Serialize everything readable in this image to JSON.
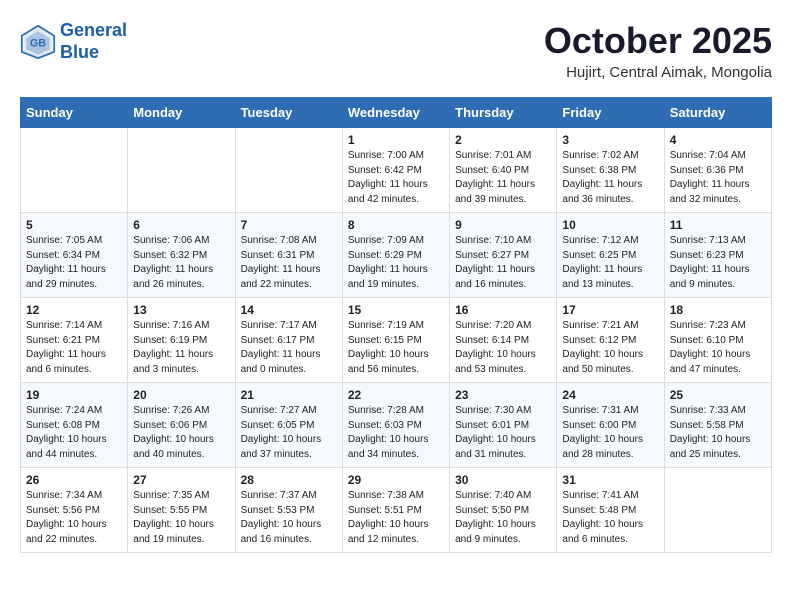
{
  "header": {
    "logo_line1": "General",
    "logo_line2": "Blue",
    "month": "October 2025",
    "location": "Hujirt, Central Aimak, Mongolia"
  },
  "days_of_week": [
    "Sunday",
    "Monday",
    "Tuesday",
    "Wednesday",
    "Thursday",
    "Friday",
    "Saturday"
  ],
  "weeks": [
    [
      {
        "day": "",
        "info": ""
      },
      {
        "day": "",
        "info": ""
      },
      {
        "day": "",
        "info": ""
      },
      {
        "day": "1",
        "info": "Sunrise: 7:00 AM\nSunset: 6:42 PM\nDaylight: 11 hours\nand 42 minutes."
      },
      {
        "day": "2",
        "info": "Sunrise: 7:01 AM\nSunset: 6:40 PM\nDaylight: 11 hours\nand 39 minutes."
      },
      {
        "day": "3",
        "info": "Sunrise: 7:02 AM\nSunset: 6:38 PM\nDaylight: 11 hours\nand 36 minutes."
      },
      {
        "day": "4",
        "info": "Sunrise: 7:04 AM\nSunset: 6:36 PM\nDaylight: 11 hours\nand 32 minutes."
      }
    ],
    [
      {
        "day": "5",
        "info": "Sunrise: 7:05 AM\nSunset: 6:34 PM\nDaylight: 11 hours\nand 29 minutes."
      },
      {
        "day": "6",
        "info": "Sunrise: 7:06 AM\nSunset: 6:32 PM\nDaylight: 11 hours\nand 26 minutes."
      },
      {
        "day": "7",
        "info": "Sunrise: 7:08 AM\nSunset: 6:31 PM\nDaylight: 11 hours\nand 22 minutes."
      },
      {
        "day": "8",
        "info": "Sunrise: 7:09 AM\nSunset: 6:29 PM\nDaylight: 11 hours\nand 19 minutes."
      },
      {
        "day": "9",
        "info": "Sunrise: 7:10 AM\nSunset: 6:27 PM\nDaylight: 11 hours\nand 16 minutes."
      },
      {
        "day": "10",
        "info": "Sunrise: 7:12 AM\nSunset: 6:25 PM\nDaylight: 11 hours\nand 13 minutes."
      },
      {
        "day": "11",
        "info": "Sunrise: 7:13 AM\nSunset: 6:23 PM\nDaylight: 11 hours\nand 9 minutes."
      }
    ],
    [
      {
        "day": "12",
        "info": "Sunrise: 7:14 AM\nSunset: 6:21 PM\nDaylight: 11 hours\nand 6 minutes."
      },
      {
        "day": "13",
        "info": "Sunrise: 7:16 AM\nSunset: 6:19 PM\nDaylight: 11 hours\nand 3 minutes."
      },
      {
        "day": "14",
        "info": "Sunrise: 7:17 AM\nSunset: 6:17 PM\nDaylight: 11 hours\nand 0 minutes."
      },
      {
        "day": "15",
        "info": "Sunrise: 7:19 AM\nSunset: 6:15 PM\nDaylight: 10 hours\nand 56 minutes."
      },
      {
        "day": "16",
        "info": "Sunrise: 7:20 AM\nSunset: 6:14 PM\nDaylight: 10 hours\nand 53 minutes."
      },
      {
        "day": "17",
        "info": "Sunrise: 7:21 AM\nSunset: 6:12 PM\nDaylight: 10 hours\nand 50 minutes."
      },
      {
        "day": "18",
        "info": "Sunrise: 7:23 AM\nSunset: 6:10 PM\nDaylight: 10 hours\nand 47 minutes."
      }
    ],
    [
      {
        "day": "19",
        "info": "Sunrise: 7:24 AM\nSunset: 6:08 PM\nDaylight: 10 hours\nand 44 minutes."
      },
      {
        "day": "20",
        "info": "Sunrise: 7:26 AM\nSunset: 6:06 PM\nDaylight: 10 hours\nand 40 minutes."
      },
      {
        "day": "21",
        "info": "Sunrise: 7:27 AM\nSunset: 6:05 PM\nDaylight: 10 hours\nand 37 minutes."
      },
      {
        "day": "22",
        "info": "Sunrise: 7:28 AM\nSunset: 6:03 PM\nDaylight: 10 hours\nand 34 minutes."
      },
      {
        "day": "23",
        "info": "Sunrise: 7:30 AM\nSunset: 6:01 PM\nDaylight: 10 hours\nand 31 minutes."
      },
      {
        "day": "24",
        "info": "Sunrise: 7:31 AM\nSunset: 6:00 PM\nDaylight: 10 hours\nand 28 minutes."
      },
      {
        "day": "25",
        "info": "Sunrise: 7:33 AM\nSunset: 5:58 PM\nDaylight: 10 hours\nand 25 minutes."
      }
    ],
    [
      {
        "day": "26",
        "info": "Sunrise: 7:34 AM\nSunset: 5:56 PM\nDaylight: 10 hours\nand 22 minutes."
      },
      {
        "day": "27",
        "info": "Sunrise: 7:35 AM\nSunset: 5:55 PM\nDaylight: 10 hours\nand 19 minutes."
      },
      {
        "day": "28",
        "info": "Sunrise: 7:37 AM\nSunset: 5:53 PM\nDaylight: 10 hours\nand 16 minutes."
      },
      {
        "day": "29",
        "info": "Sunrise: 7:38 AM\nSunset: 5:51 PM\nDaylight: 10 hours\nand 12 minutes."
      },
      {
        "day": "30",
        "info": "Sunrise: 7:40 AM\nSunset: 5:50 PM\nDaylight: 10 hours\nand 9 minutes."
      },
      {
        "day": "31",
        "info": "Sunrise: 7:41 AM\nSunset: 5:48 PM\nDaylight: 10 hours\nand 6 minutes."
      },
      {
        "day": "",
        "info": ""
      }
    ]
  ]
}
